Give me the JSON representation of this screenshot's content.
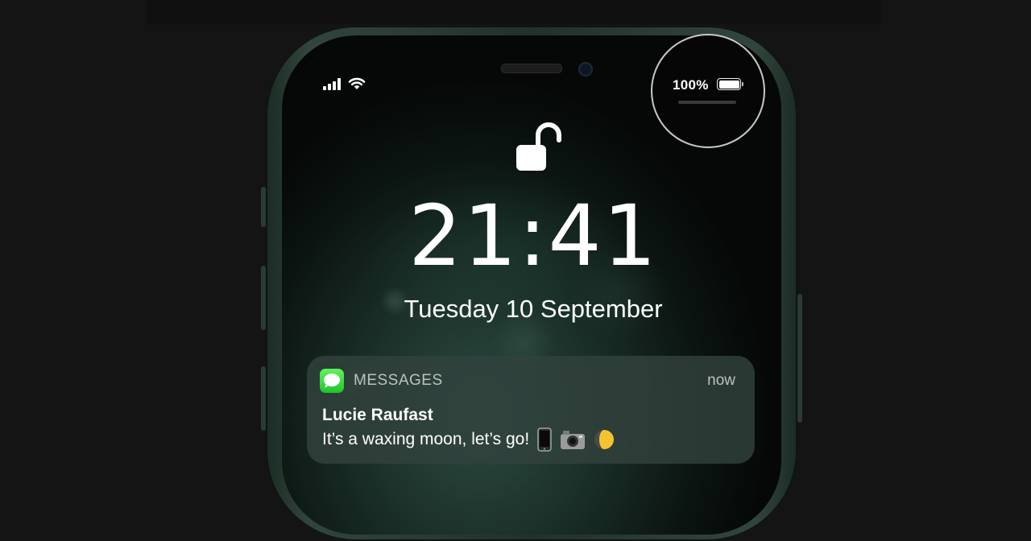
{
  "status_bar": {
    "battery_percent": "100%",
    "battery_level": 1.0,
    "icons": [
      "signal-icon",
      "wifi-icon",
      "battery-icon"
    ]
  },
  "lock_screen": {
    "lock_state_icon": "unlocked-padlock-icon",
    "time": "21:41",
    "date": "Tuesday 10 September"
  },
  "notification": {
    "app_icon": "messages-app-icon",
    "app_name": "MESSAGES",
    "time": "now",
    "sender": "Lucie Raufast",
    "message": "It’s a waxing moon, let’s go!",
    "message_emojis": [
      "mobile-phone-emoji",
      "camera-emoji",
      "waxing-moon-emoji"
    ]
  },
  "colors": {
    "background": "#141414",
    "frame": "#31453c",
    "notification_bg": "#32423d",
    "messages_green": "#34c759",
    "text_primary": "#ffffff",
    "text_secondary": "#b9c3bf"
  }
}
